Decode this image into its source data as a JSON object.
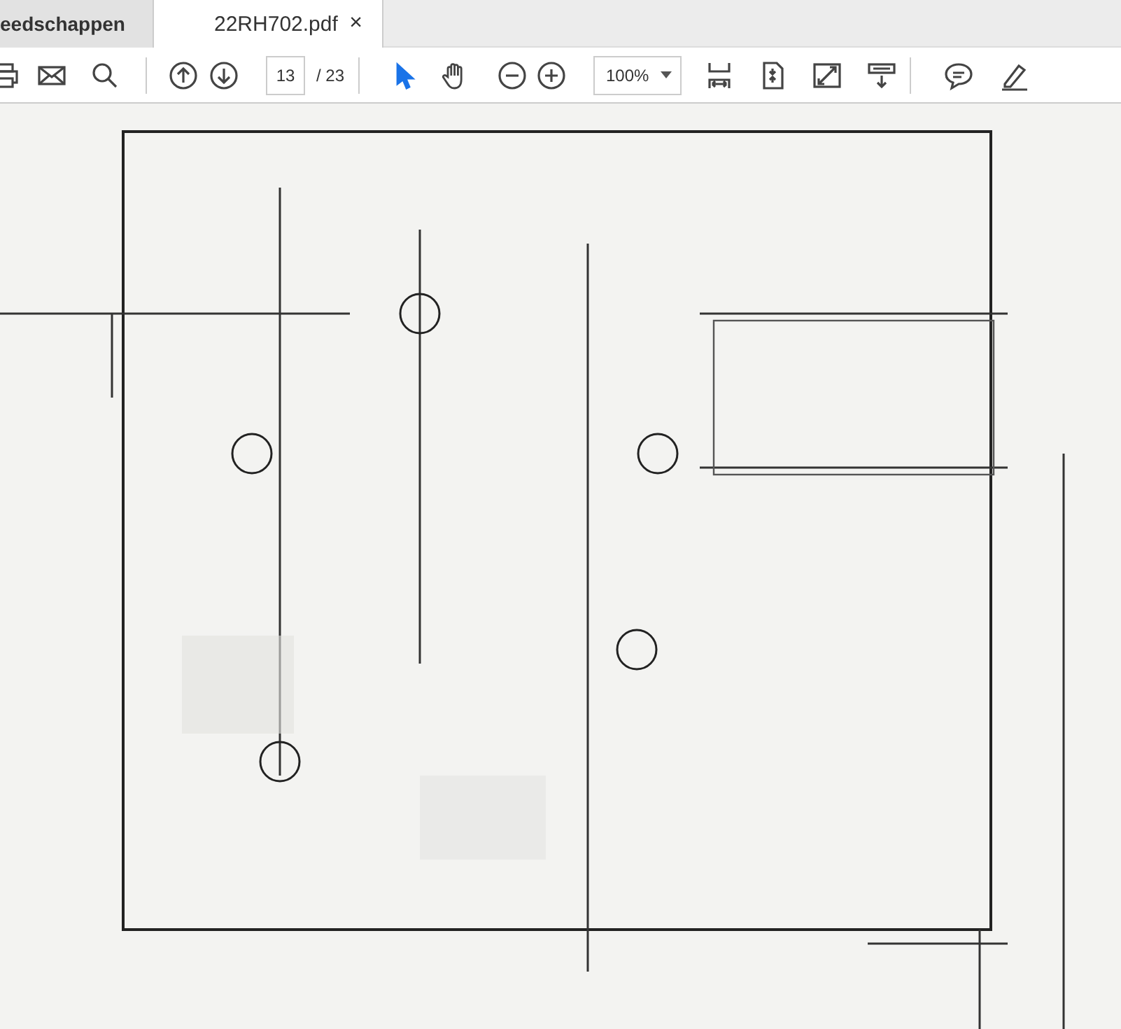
{
  "tabs": [
    {
      "label": "eedschappen",
      "selected": false
    },
    {
      "label": "22RH702.pdf",
      "selected": true,
      "close": "×"
    }
  ],
  "toolbar": {
    "page_number": "13",
    "page_count": "/ 23",
    "zoom": "100%",
    "tools": [
      {
        "kind": "pointer",
        "selected": true
      },
      {
        "kind": "hand",
        "selected": false
      }
    ]
  }
}
